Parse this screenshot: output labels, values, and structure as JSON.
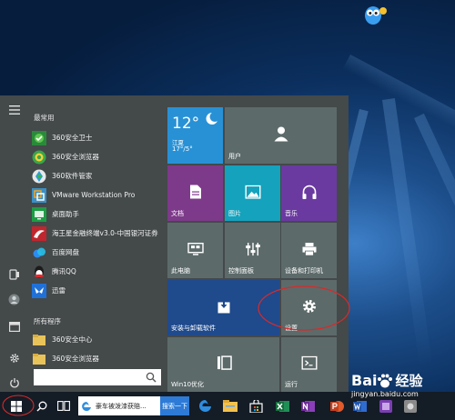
{
  "start_menu": {
    "most_used_header": "最常用",
    "most_used": [
      {
        "label": "360安全卫士",
        "icon": "360-safe-guard-icon"
      },
      {
        "label": "360安全浏览器",
        "icon": "360-browser-icon"
      },
      {
        "label": "360软件管家",
        "icon": "360-software-manager-icon"
      },
      {
        "label": "VMware Workstation Pro",
        "icon": "vmware-icon"
      },
      {
        "label": "桌面助手",
        "icon": "desktop-assistant-icon"
      },
      {
        "label": "海王星金融终端v3.0-中国银河证券",
        "icon": "neptune-finance-icon"
      },
      {
        "label": "百度网盘",
        "icon": "baidu-netdisk-icon"
      },
      {
        "label": "腾讯QQ",
        "icon": "qq-icon"
      },
      {
        "label": "迅雷",
        "icon": "thunder-icon"
      }
    ],
    "all_programs_header": "所有程序",
    "all_programs": [
      {
        "label": "360安全中心",
        "icon": "folder-icon"
      },
      {
        "label": "360安全浏览器",
        "icon": "folder-icon"
      }
    ],
    "tiles": {
      "weather": {
        "temp": "12°",
        "city": "江夏",
        "range": "17°/5°"
      },
      "user": {
        "label": "用户"
      },
      "documents": {
        "label": "文档"
      },
      "pictures": {
        "label": "图片"
      },
      "music": {
        "label": "音乐"
      },
      "this_pc": {
        "label": "此电脑"
      },
      "control_panel": {
        "label": "控制面板"
      },
      "devices_printers": {
        "label": "设备和打印机"
      },
      "install_uninstall": {
        "label": "安装与卸载软件"
      },
      "settings": {
        "label": "设置"
      },
      "win10_optimize": {
        "label": "Win10优化"
      },
      "run": {
        "label": "运行"
      }
    }
  },
  "taskbar": {
    "search_text": "豪车被泼漆获赔...",
    "search_button": "搜索一下"
  },
  "watermark": {
    "brand": "Bai",
    "brand2": "经验",
    "url": "jingyan.baidu.com"
  },
  "colors": {
    "desktop": "#0b2f5e",
    "start_menu_bg": "#44494a",
    "tile_blue": "#2891d6",
    "tile_gray": "#5d6a6a",
    "tile_purple": "#7e3a8a",
    "tile_teal": "#14a2bd",
    "tile_violet": "#6a3aa0",
    "tile_navy": "#1f4a8c",
    "highlight_red": "#d92a2a"
  }
}
